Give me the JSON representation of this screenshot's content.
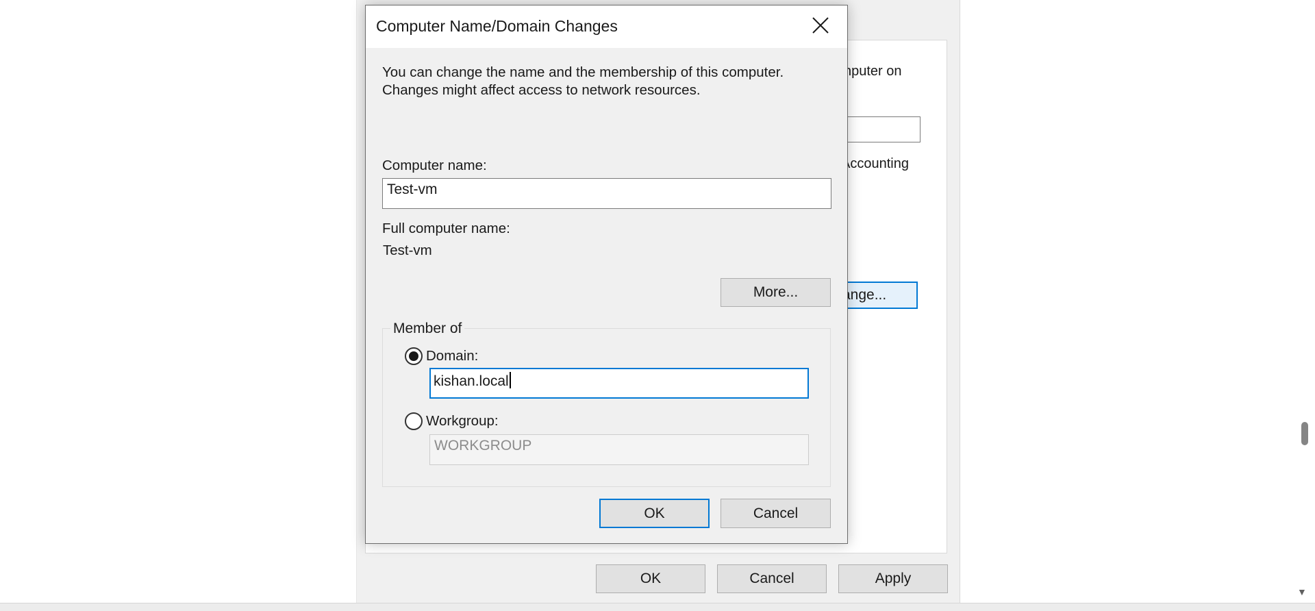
{
  "background_window": {
    "text_fragments": [
      "nputer on",
      "Accounting"
    ],
    "change_button_label": "ange...",
    "ok_label": "OK",
    "cancel_label": "Cancel",
    "apply_label": "Apply"
  },
  "dialog": {
    "title": "Computer Name/Domain Changes",
    "description_line1": "You can change the name and the membership of this computer.",
    "description_line2": "Changes might affect access to network resources.",
    "computer_name_label": "Computer name:",
    "computer_name_value": "Test-vm",
    "full_computer_name_label": "Full computer name:",
    "full_computer_name_value": "Test-vm",
    "more_button_label": "More...",
    "member_of": {
      "legend": "Member of",
      "domain_label": "Domain:",
      "domain_value": "kishan.local",
      "domain_selected": true,
      "workgroup_label": "Workgroup:",
      "workgroup_value": "WORKGROUP",
      "workgroup_selected": false
    },
    "ok_label": "OK",
    "cancel_label": "Cancel"
  },
  "colors": {
    "accent": "#0078d4",
    "dialog_bg": "#f0f0f0",
    "button_bg": "#e1e1e1"
  }
}
